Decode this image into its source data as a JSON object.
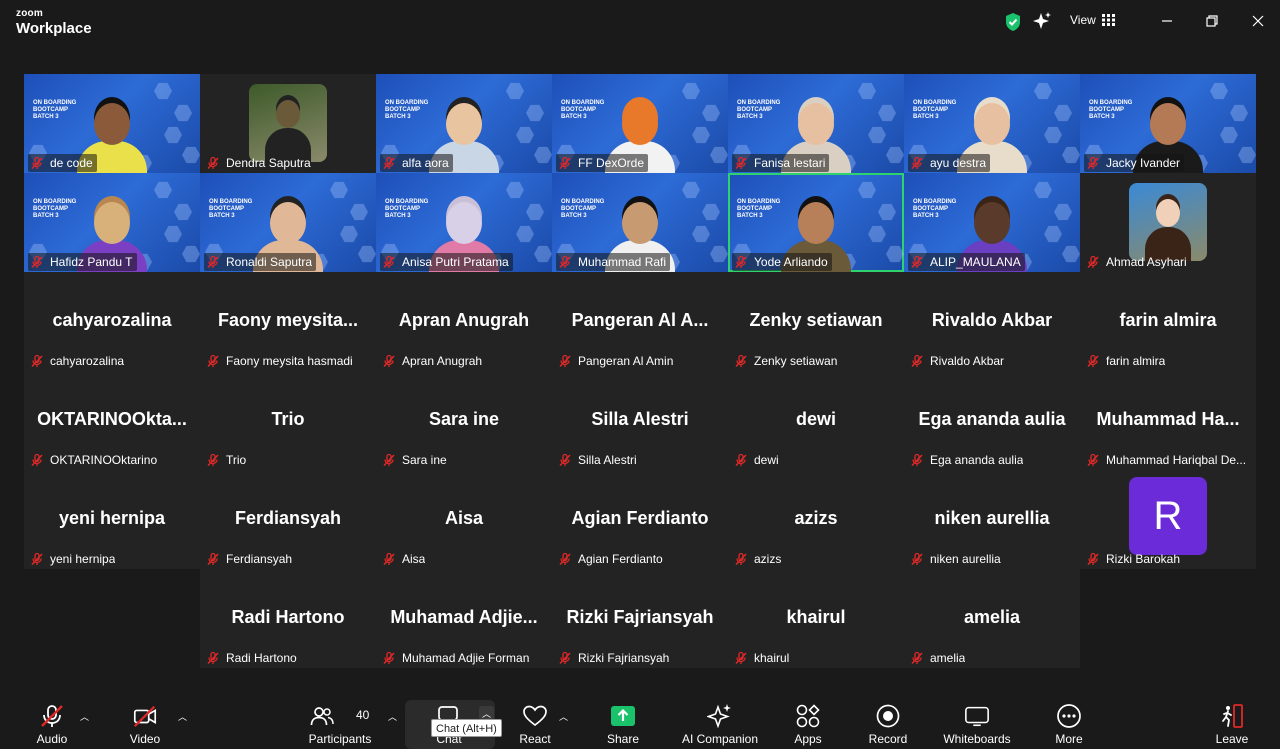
{
  "app": {
    "brand_small": "zoom",
    "brand_name": "Workplace",
    "view_label": "View"
  },
  "tiles": [
    {
      "name": "de code",
      "type": "video",
      "banner": "ON BOARDING\nBOOTCAMP\nBATCH 3",
      "skin": "#8a5a3a",
      "shirt": "#e9e04a",
      "hair": "#111"
    },
    {
      "name": "Dendra Saputra",
      "type": "photo-plain",
      "skin": "#6a5a3a",
      "shirt": "#3d5a2a",
      "hair": "#222"
    },
    {
      "name": "alfa aora",
      "type": "video",
      "banner": "ON BOARDING\nBOOTCAMP\nBATCH 3",
      "skin": "#e8c4a0",
      "shirt": "#c9d6e6",
      "hair": "#222"
    },
    {
      "name": "FF DexOrde",
      "type": "video",
      "banner": "ON BOARDING\nBOOTCAMP\nBATCH 3",
      "skin": "#e8782a",
      "shirt": "#f2f2f2",
      "hair": "#e8782a"
    },
    {
      "name": "Fanisa lestari",
      "type": "video",
      "banner": "ON BOARDING\nBOOTCAMP\nBATCH 3",
      "skin": "#e6c0a0",
      "shirt": "#d9cfc2",
      "hair": "#d9cfc2"
    },
    {
      "name": "ayu destra",
      "type": "video",
      "banner": "ON BOARDING\nBOOTCAMP\nBATCH 3",
      "skin": "#e6c0a0",
      "shirt": "#e8dccb",
      "hair": "#e8dccb"
    },
    {
      "name": "Jacky Ivander",
      "type": "video",
      "banner": "ON BOARDING\nBOOTCAMP\nBATCH 3",
      "skin": "#b47a55",
      "shirt": "#1a1a1a",
      "hair": "#111"
    },
    {
      "name": "Hafidz Pandu T",
      "type": "video",
      "banner": "ON BOARDING\nBOOTCAMP\nBATCH 3",
      "skin": "#d8b07a",
      "shirt": "#7a3fc2",
      "hair": "#b8864e"
    },
    {
      "name": "Ronaldi Saputra",
      "type": "video",
      "banner": "ON BOARDING\nBOOTCAMP\nBATCH 3",
      "skin": "#e0b898",
      "shirt": "#e0b898",
      "hair": "#222"
    },
    {
      "name": "Anisa Putri Pratama",
      "type": "video",
      "banner": "ON BOARDING\nBOOTCAMP\nBATCH 3",
      "skin": "#d8d0e6",
      "shirt": "#e07aa6",
      "hair": "#c9c0d8"
    },
    {
      "name": "Muhammad Rafi",
      "type": "video",
      "banner": "ON BOARDING\nBOOTCAMP\nBATCH 3",
      "skin": "#c89a72",
      "shirt": "#f0f0f0",
      "hair": "#111"
    },
    {
      "name": "Yode Arliando",
      "type": "video",
      "banner": "ON BOARDING\nBOOTCAMP\nBATCH 3",
      "skin": "#b88058",
      "shirt": "#6a5a3a",
      "hair": "#111",
      "active": true
    },
    {
      "name": "ALIP_MAULANA",
      "type": "video",
      "banner": "ON BOARDING\nBOOTCAMP\nBATCH 3",
      "skin": "#5a3a2a",
      "shirt": "#6a3fc2",
      "hair": "#3a2418"
    },
    {
      "name": "Ahmad Asyhari",
      "type": "photo-plain",
      "skin": "#f0d0b8",
      "shirt": "#3a8ad6",
      "hair": "#3a2418"
    },
    {
      "name": "cahyarozalina",
      "display": "cahyarozalina",
      "type": "name"
    },
    {
      "name": "Faony meysita hasmadi",
      "display": "Faony  meysita...",
      "type": "name"
    },
    {
      "name": "Apran Anugrah",
      "display": "Apran Anugrah",
      "type": "name"
    },
    {
      "name": "Pangeran Al Amin",
      "display": "Pangeran  Al  A...",
      "type": "name"
    },
    {
      "name": "Zenky setiawan",
      "display": "Zenky setiawan",
      "type": "name"
    },
    {
      "name": "Rivaldo Akbar",
      "display": "Rivaldo Akbar",
      "type": "name"
    },
    {
      "name": "farin almira",
      "display": "farin almira",
      "type": "name"
    },
    {
      "name": "OKTARINOOktarino",
      "display": "OKTARINOOkta...",
      "type": "name"
    },
    {
      "name": "Trio",
      "display": "Trio",
      "type": "name"
    },
    {
      "name": "Sara ine",
      "display": "Sara ine",
      "type": "name"
    },
    {
      "name": "Silla Alestri",
      "display": "Silla Alestri",
      "type": "name"
    },
    {
      "name": "dewi",
      "display": "dewi",
      "type": "name"
    },
    {
      "name": "Ega ananda aulia",
      "display": "Ega ananda aulia",
      "type": "name"
    },
    {
      "name": "Muhammad Hariqbal De...",
      "display": "Muhammad  Ha...",
      "type": "name"
    },
    {
      "name": "yeni hernipa",
      "display": "yeni hernipa",
      "type": "name"
    },
    {
      "name": "Ferdiansyah",
      "display": "Ferdiansyah",
      "type": "name"
    },
    {
      "name": "Aisa",
      "display": "Aisa",
      "type": "name"
    },
    {
      "name": "Agian Ferdianto",
      "display": "Agian Ferdianto",
      "type": "name"
    },
    {
      "name": "azizs",
      "display": "azizs",
      "type": "name"
    },
    {
      "name": "niken aurellia",
      "display": "niken aurellia",
      "type": "name"
    },
    {
      "name": "Rizki Barokah",
      "type": "avatar",
      "letter": "R"
    },
    {
      "name": "Radi Hartono",
      "display": "Radi Hartono",
      "type": "name"
    },
    {
      "name": "Muhamad Adjie Forman",
      "display": "Muhamad  Adjie...",
      "type": "name"
    },
    {
      "name": "Rizki Fajriansyah",
      "display": "Rizki Fajriansyah",
      "type": "name"
    },
    {
      "name": "khairul",
      "display": "khairul",
      "type": "name"
    },
    {
      "name": "amelia",
      "display": "amelia",
      "type": "name"
    }
  ],
  "toolbar": {
    "audio": "Audio",
    "video": "Video",
    "participants": "Participants",
    "participants_count": "40",
    "chat": "Chat",
    "chat_tooltip": "Chat (Alt+H)",
    "react": "React",
    "share": "Share",
    "ai_companion": "AI Companion",
    "apps": "Apps",
    "record": "Record",
    "whiteboards": "Whiteboards",
    "more": "More",
    "leave": "Leave"
  },
  "colors": {
    "accent_green": "#2fd36e",
    "share_green": "#19c26b",
    "muted_red": "#e02828",
    "avatar_purple": "#6b2bd8",
    "banner_blue": "#2d6bd6"
  }
}
